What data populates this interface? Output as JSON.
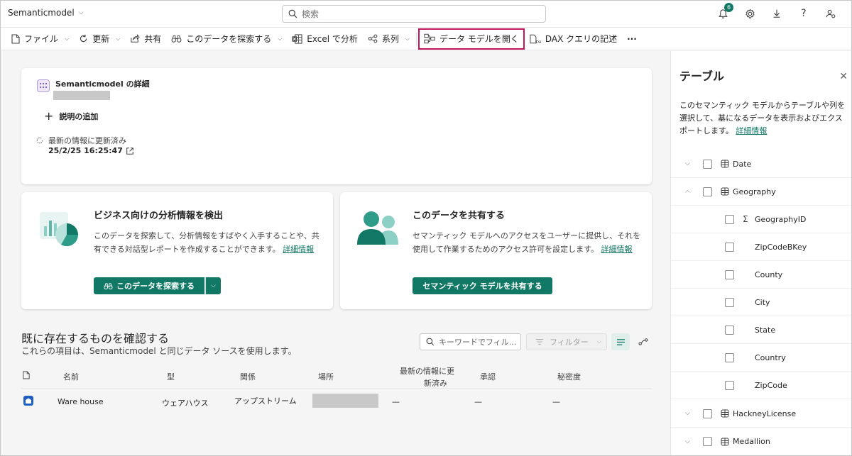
{
  "topbar": {
    "app_title": "Semanticmodel",
    "search_placeholder": "検索",
    "notification_count": "6"
  },
  "ribbon": {
    "file": "ファイル",
    "refresh": "更新",
    "share": "共有",
    "explore": "このデータを探索する",
    "excel": "Excel で分析",
    "lineage": "系列",
    "open_model": "データ モデルを開く",
    "dax": "DAX クエリの記述",
    "more": "···"
  },
  "details": {
    "title": "Semanticmodel の詳細",
    "add_description": "説明の追加",
    "refresh_status": "最新の情報に更新済み",
    "refresh_time": "25/2/25 16:25:47"
  },
  "promo_insights": {
    "title": "ビジネス向けの分析情報を検出",
    "text": "このデータを探索して、分析情報をすばやく入手することや、共有できる対話型レポートを作成することができます。",
    "link": "詳細情報",
    "button": "このデータを探索する"
  },
  "promo_share": {
    "title": "このデータを共有する",
    "text": "セマンティック モデルへのアクセスをユーザーに提供し、それを使用して作業するためのアクセス許可を設定します。",
    "link": "詳細情報",
    "button": "セマンティック モデルを共有する"
  },
  "existing": {
    "title": "既に存在するものを確認する",
    "subtitle": "これらの項目は、Semanticmodel と同じデータ ソースを使用します。",
    "keyword_placeholder": "キーワードでフィル...",
    "filter_label": "フィルター",
    "columns": {
      "name": "名前",
      "type": "型",
      "relation": "関係",
      "location": "場所",
      "refreshed_line1": "最新の情報に更",
      "refreshed_line2": "新済み",
      "endorsement": "承認",
      "sensitivity": "秘密度"
    },
    "rows": [
      {
        "name": "Ware house",
        "type": "ウェアハウス",
        "relation": "アップストリーム",
        "refreshed": "—",
        "endorsement": "—",
        "sensitivity": "—"
      }
    ]
  },
  "panel": {
    "title": "テーブル",
    "description": "このセマンティック モデルからテーブルや列を選択して、基になるデータを表示およびエクスポートします。",
    "link": "詳細情報",
    "tables": [
      {
        "label": "Date"
      },
      {
        "label": "Geography"
      },
      {
        "label": "GeographyID"
      },
      {
        "label": "ZipCodeBKey"
      },
      {
        "label": "County"
      },
      {
        "label": "City"
      },
      {
        "label": "State"
      },
      {
        "label": "Country"
      },
      {
        "label": "ZipCode"
      },
      {
        "label": "HackneyLicense"
      },
      {
        "label": "Medallion"
      }
    ]
  },
  "colors": {
    "accent": "#117865",
    "highlight_border": "#c2185b"
  }
}
